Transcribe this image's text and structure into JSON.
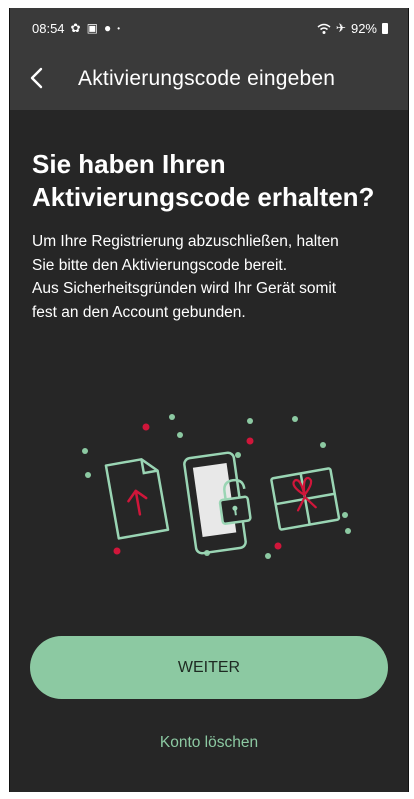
{
  "status_bar": {
    "time": "08:54",
    "battery": "92%",
    "icons": [
      "settings-icon",
      "gallery-icon",
      "location-icon",
      "dot-icon",
      "wifi-icon",
      "airplane-icon",
      "battery-icon"
    ]
  },
  "app_bar": {
    "back_icon": "chevron-left-icon",
    "title": "Aktivierungscode eingeben"
  },
  "content": {
    "headline_line1": "Sie haben Ihren",
    "headline_line2": "Aktivierungscode erhalten?",
    "body_line1": "Um Ihre Registrierung abzuschließen, halten",
    "body_line2": "Sie bitte den Aktivierungscode bereit.",
    "body_line3": "Aus Sicherheitsgründen wird Ihr Gerät somit",
    "body_line4": "fest an den Account gebunden."
  },
  "illustration": {
    "icons": [
      "document-upload-icon",
      "phone-unlock-icon",
      "gift-icon"
    ],
    "line_color": "#9ad5b4",
    "dot_green": "#8cc9a2",
    "dot_red": "#d0163a"
  },
  "actions": {
    "primary_label": "WEITER",
    "secondary_label": "Konto löschen"
  },
  "colors": {
    "background": "#262626",
    "bar": "#3a3a3a",
    "accent": "#8cc9a2"
  }
}
